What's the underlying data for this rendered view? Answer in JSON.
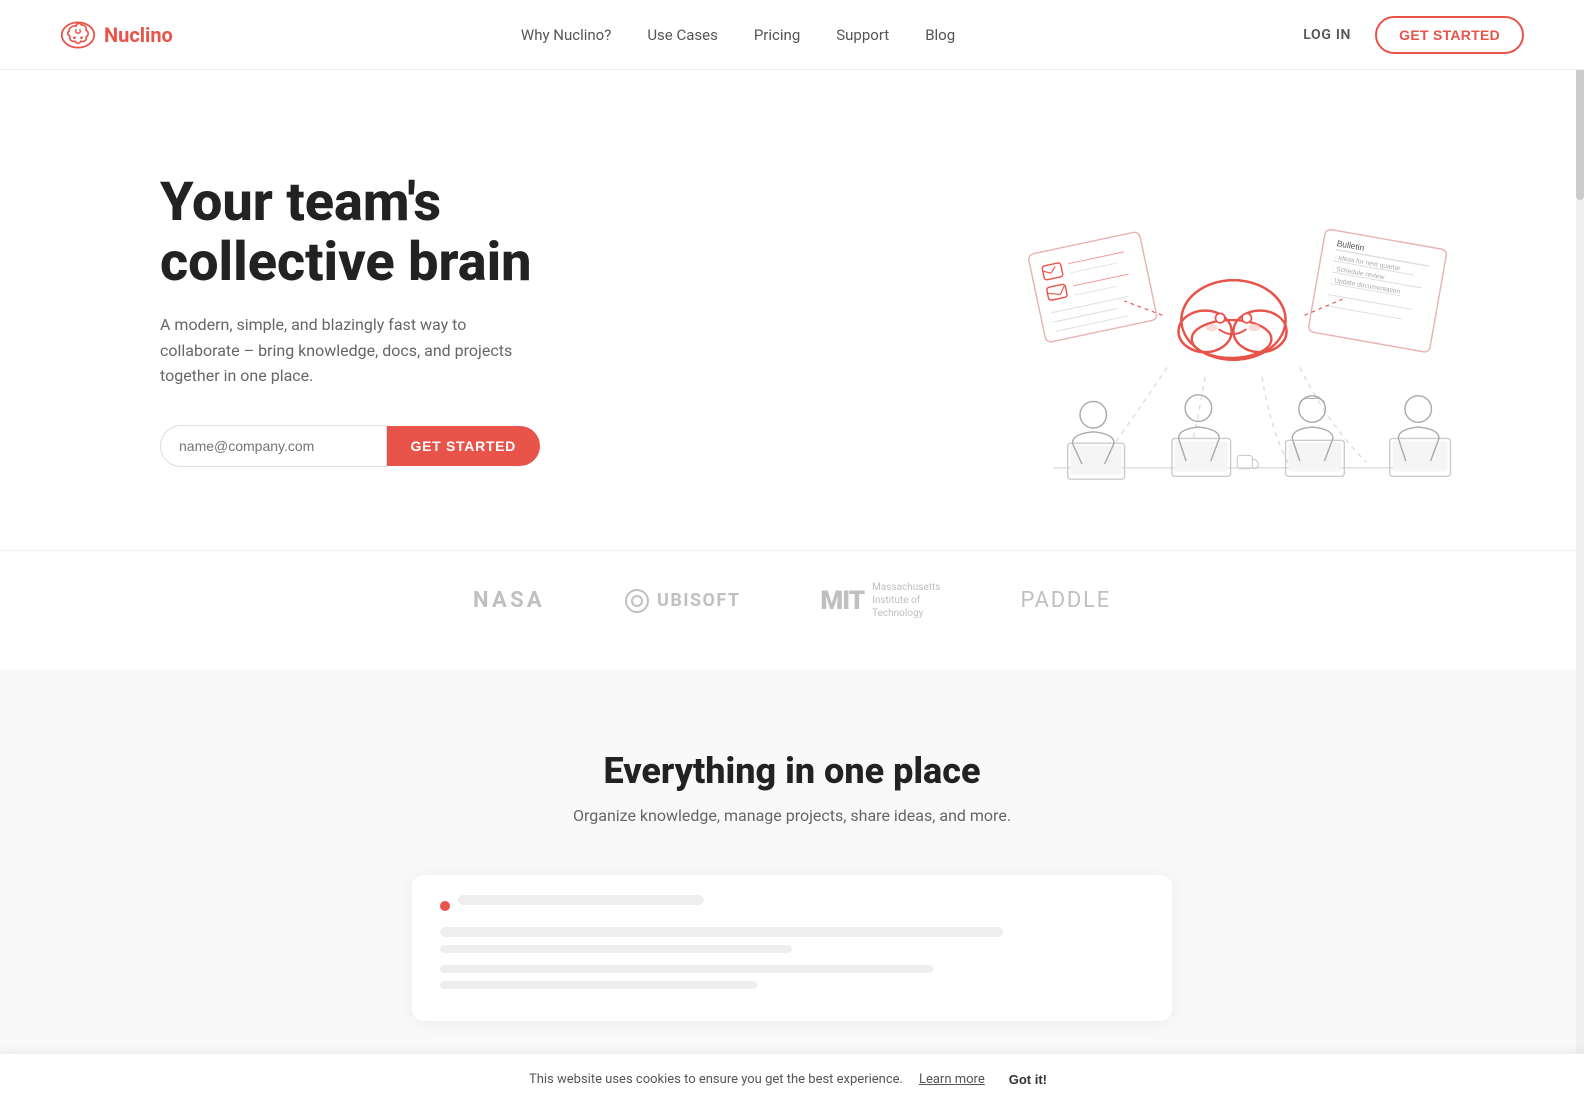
{
  "meta": {
    "title": "Nuclino - Your team's collective brain"
  },
  "navbar": {
    "logo_text": "Nuclino",
    "links": [
      {
        "label": "Why Nuclino?",
        "href": "#"
      },
      {
        "label": "Use Cases",
        "href": "#"
      },
      {
        "label": "Pricing",
        "href": "#"
      },
      {
        "label": "Support",
        "href": "#"
      },
      {
        "label": "Blog",
        "href": "#"
      }
    ],
    "login_label": "LOG IN",
    "get_started_label": "GET STARTED"
  },
  "hero": {
    "title_line1": "Your team's",
    "title_line2": "collective brain",
    "subtitle": "A modern, simple, and blazingly fast way to collaborate – bring knowledge, docs, and projects together in one place.",
    "email_placeholder": "name@company.com",
    "cta_label": "GET STARTED"
  },
  "partners": [
    {
      "name": "NASA",
      "style": "nasa"
    },
    {
      "name": "UBISOFT",
      "style": "ubisoft"
    },
    {
      "name": "MIT",
      "style": "mit",
      "full": "Massachusetts Institute of Technology"
    },
    {
      "name": "paddle",
      "style": "paddle"
    }
  ],
  "features": {
    "title": "Everything in one place",
    "subtitle": "Organize knowledge, manage projects, share ideas, and more."
  },
  "cookie": {
    "text": "This website uses cookies to ensure you get the best experience.",
    "learn_more": "Learn more",
    "got_it": "Got it!"
  }
}
